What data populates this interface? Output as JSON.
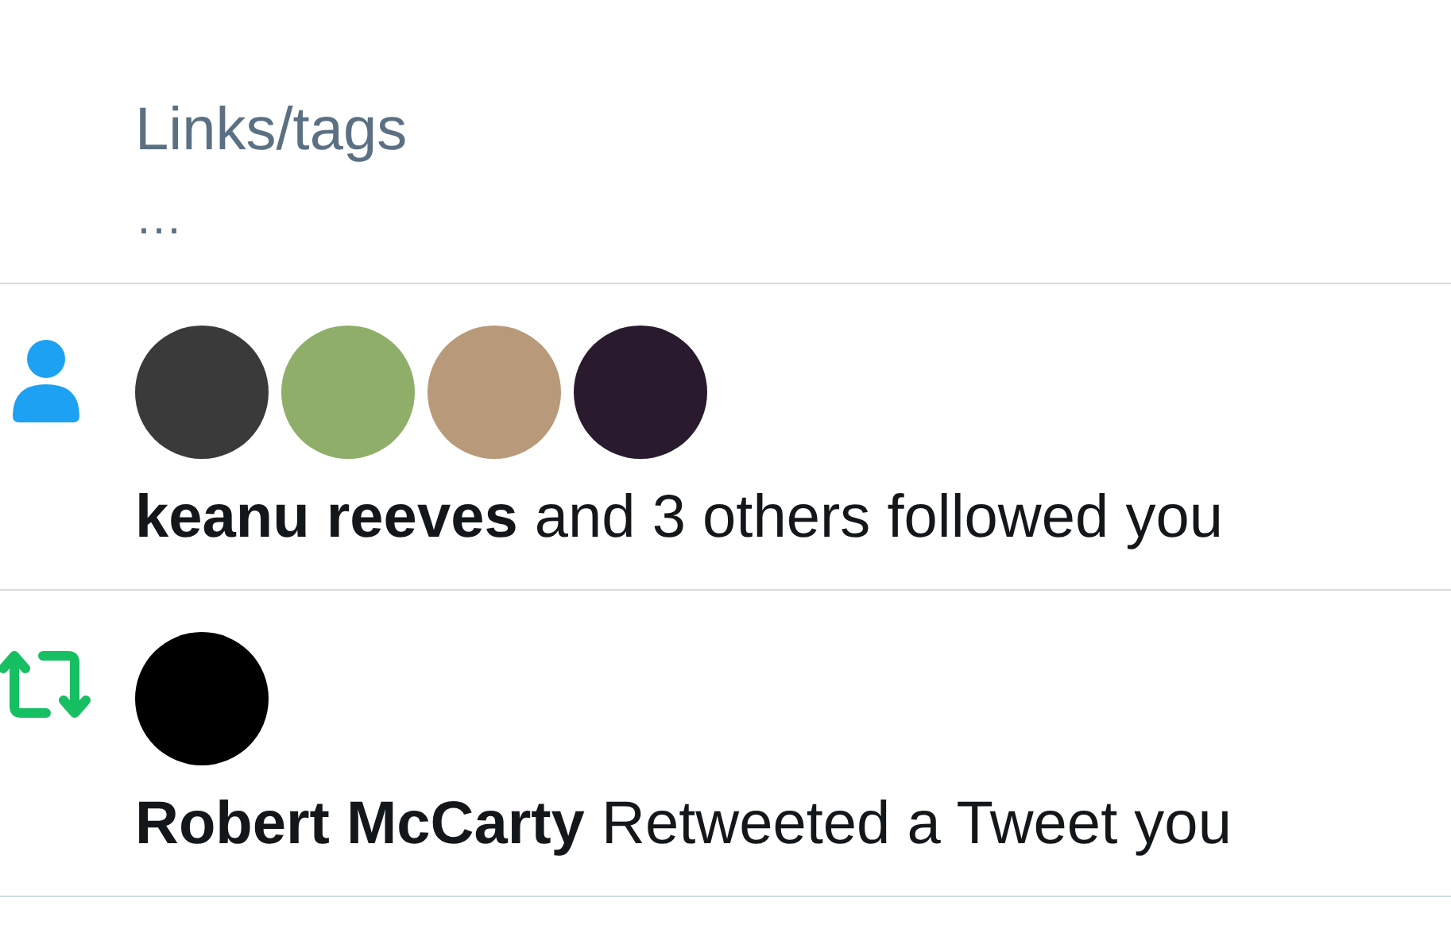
{
  "tweet": {
    "text": "Links/tags",
    "more": "…"
  },
  "notifications": [
    {
      "kind": "follow",
      "avatars": [
        {
          "kind": "photo"
        },
        {
          "kind": "photo"
        },
        {
          "kind": "photo"
        },
        {
          "kind": "photo"
        }
      ],
      "text": "**keanu reeves** and 3 others followed you"
    },
    {
      "kind": "retweet",
      "avatars": [
        {
          "kind": "photo"
        }
      ],
      "text": "**Robert McCarty** Retweeted a Tweet you"
    }
  ]
}
